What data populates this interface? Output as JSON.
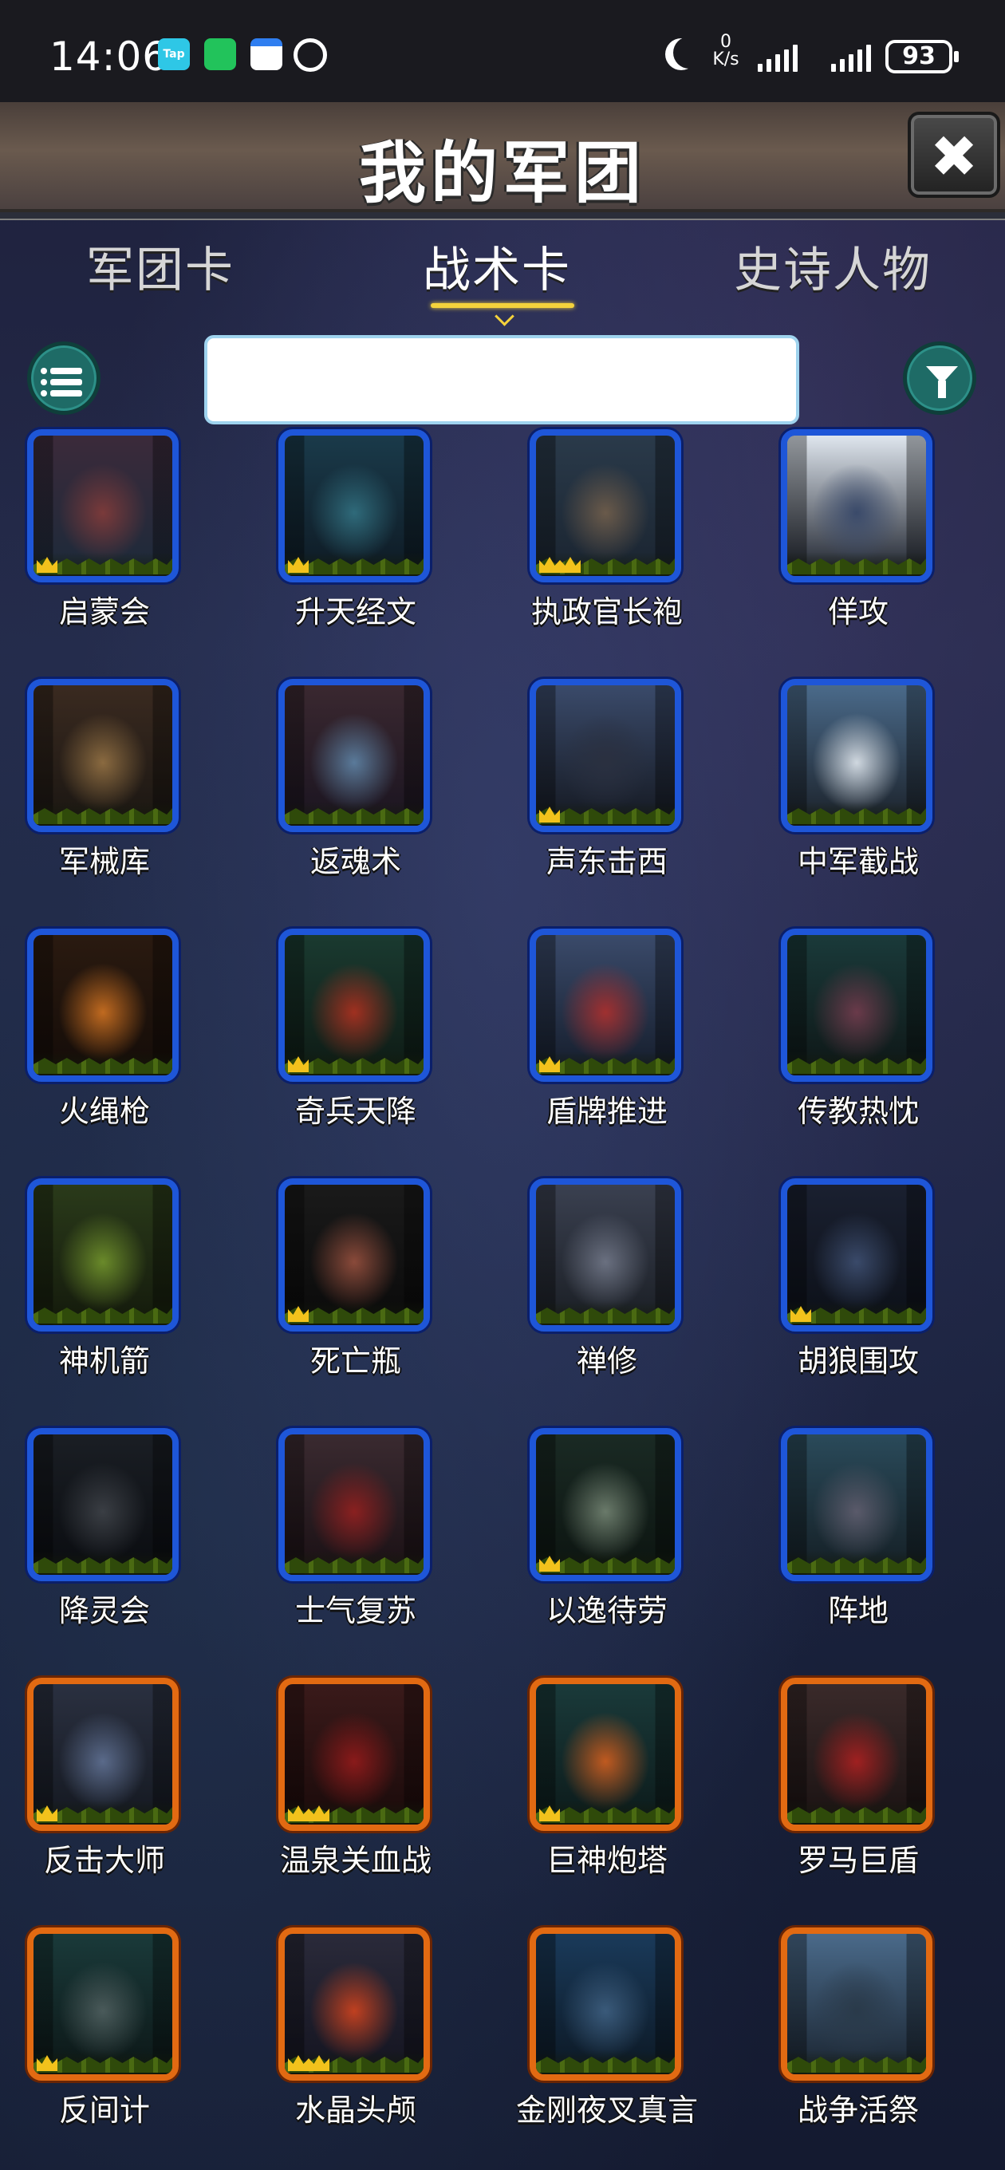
{
  "status_bar": {
    "time": "14:06",
    "app_icons": [
      "tap-icon",
      "wechat-icon",
      "calendar-icon",
      "alarm-icon"
    ],
    "net_speed_value": "0",
    "net_speed_unit": "K/s",
    "battery": "93",
    "tap_label": "Tap"
  },
  "header": {
    "title": "我的军团",
    "close_label": "✖"
  },
  "tabs": [
    {
      "label": "军团卡",
      "active": false
    },
    {
      "label": "战术卡",
      "active": true
    },
    {
      "label": "史诗人物",
      "active": false
    }
  ],
  "search": {
    "value": "",
    "placeholder": ""
  },
  "colors": {
    "rarity_blue": "#1e56d8",
    "rarity_orange": "#e26a12",
    "accent_teal": "#1e6b66",
    "tab_indicator": "#f4d23c"
  },
  "cards": [
    {
      "name": "启蒙会",
      "rarity": "blue",
      "gold_crowns": 1
    },
    {
      "name": "升天经文",
      "rarity": "blue",
      "gold_crowns": 1
    },
    {
      "name": "执政官长袍",
      "rarity": "blue",
      "gold_crowns": 2
    },
    {
      "name": "佯攻",
      "rarity": "blue",
      "gold_crowns": 0
    },
    {
      "name": "军械库",
      "rarity": "blue",
      "gold_crowns": 0
    },
    {
      "name": "返魂术",
      "rarity": "blue",
      "gold_crowns": 0
    },
    {
      "name": "声东击西",
      "rarity": "blue",
      "gold_crowns": 1
    },
    {
      "name": "中军截战",
      "rarity": "blue",
      "gold_crowns": 0
    },
    {
      "name": "火绳枪",
      "rarity": "blue",
      "gold_crowns": 0
    },
    {
      "name": "奇兵天降",
      "rarity": "blue",
      "gold_crowns": 1
    },
    {
      "name": "盾牌推进",
      "rarity": "blue",
      "gold_crowns": 1
    },
    {
      "name": "传教热忱",
      "rarity": "blue",
      "gold_crowns": 0
    },
    {
      "name": "神机箭",
      "rarity": "blue",
      "gold_crowns": 0
    },
    {
      "name": "死亡瓶",
      "rarity": "blue",
      "gold_crowns": 1
    },
    {
      "name": "禅修",
      "rarity": "blue",
      "gold_crowns": 0
    },
    {
      "name": "胡狼围攻",
      "rarity": "blue",
      "gold_crowns": 1
    },
    {
      "name": "降灵会",
      "rarity": "blue",
      "gold_crowns": 0
    },
    {
      "name": "士气复苏",
      "rarity": "blue",
      "gold_crowns": 0
    },
    {
      "name": "以逸待劳",
      "rarity": "blue",
      "gold_crowns": 1
    },
    {
      "name": "阵地",
      "rarity": "blue",
      "gold_crowns": 0
    },
    {
      "name": "反击大师",
      "rarity": "orange",
      "gold_crowns": 1
    },
    {
      "name": "温泉关血战",
      "rarity": "orange",
      "gold_crowns": 2
    },
    {
      "name": "巨神炮塔",
      "rarity": "orange",
      "gold_crowns": 1
    },
    {
      "name": "罗马巨盾",
      "rarity": "orange",
      "gold_crowns": 0
    },
    {
      "name": "反间计",
      "rarity": "orange",
      "gold_crowns": 1
    },
    {
      "name": "水晶头颅",
      "rarity": "orange",
      "gold_crowns": 2
    },
    {
      "name": "金刚夜叉真言",
      "rarity": "orange",
      "gold_crowns": 0
    },
    {
      "name": "战争活祭",
      "rarity": "orange",
      "gold_crowns": 0
    }
  ]
}
